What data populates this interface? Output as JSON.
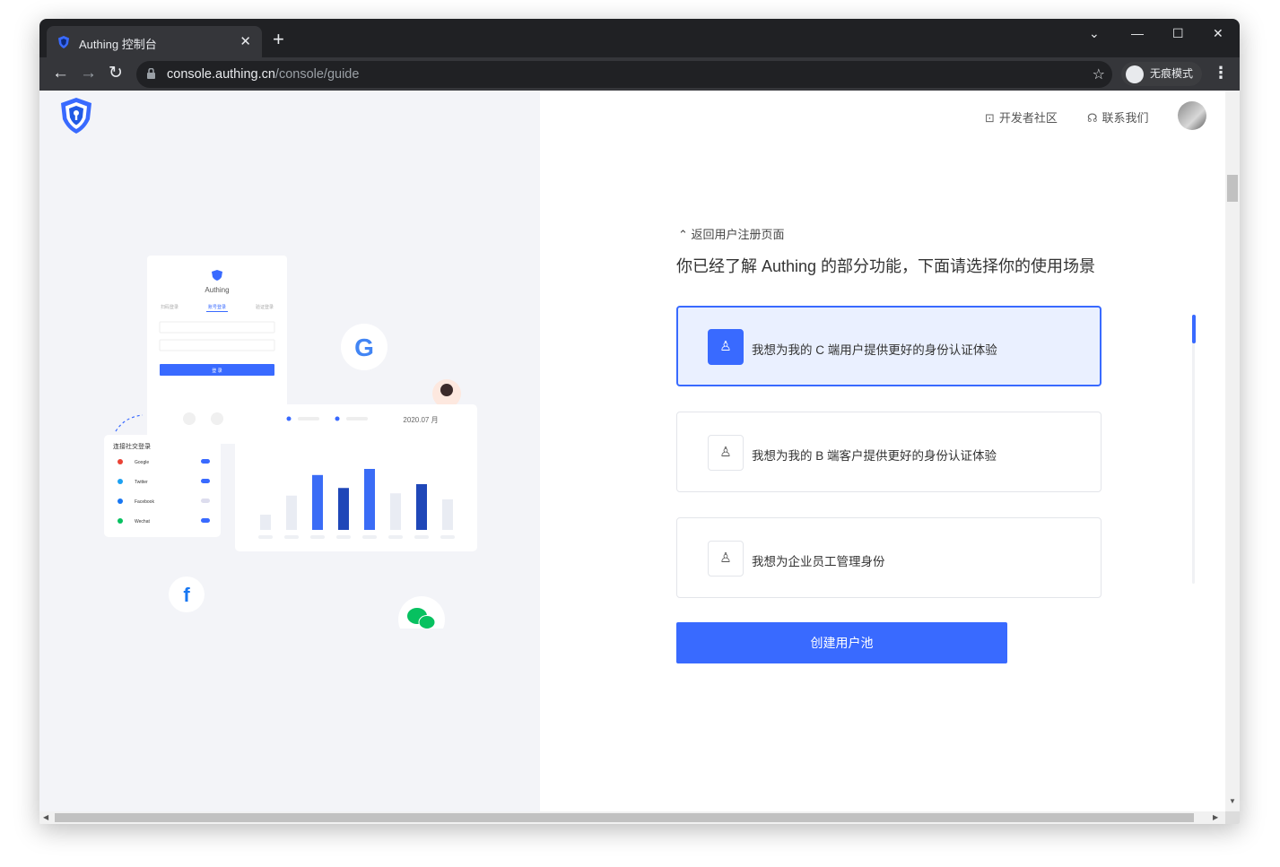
{
  "browser": {
    "tab_title": "Authing 控制台",
    "tab_close": "✕",
    "new_tab": "+",
    "url_host": "console.authing.cn",
    "url_path": "/console/guide",
    "incognito_label": "无痕模式",
    "icons": [
      "back-icon",
      "forward-icon",
      "reload-icon",
      "lock-icon",
      "star-icon",
      "incognito-icon",
      "kebab-menu-icon",
      "minimize-icon",
      "maximize-icon",
      "close-icon",
      "tab-search-icon"
    ]
  },
  "header": {
    "developer_community": "开发者社区",
    "contact_us": "联系我们"
  },
  "guide": {
    "back_link": "返回用户注册页面",
    "heading": "你已经了解 Authing 的部分功能，下面请选择你的使用场景",
    "options": [
      {
        "label": "我想为我的 C 端用户提供更好的身份认证体验",
        "selected": true,
        "icon": "user-c-icon"
      },
      {
        "label": "我想为我的 B 端客户提供更好的身份认证体验",
        "selected": false,
        "icon": "user-b-icon"
      },
      {
        "label": "我想为企业员工管理身份",
        "selected": false,
        "icon": "employee-icon"
      }
    ],
    "create_button": "创建用户池"
  },
  "illustration": {
    "login_card_title": "Authing",
    "login_tabs": [
      "扫码登录",
      "账号登录",
      "验证登录"
    ],
    "login_button": "登 录",
    "social_card_title": "连接社交登录",
    "social_items": [
      "Google",
      "Twitter",
      "Facebook",
      "Wechat"
    ],
    "chart_date": "2020.07 月",
    "bars": [
      0.2,
      0.45,
      0.72,
      0.55,
      0.8,
      0.48,
      0.6,
      0.4
    ]
  },
  "colors": {
    "accent": "#396aff",
    "left_bg": "#f3f4f8",
    "chrome_dark": "#202124"
  }
}
